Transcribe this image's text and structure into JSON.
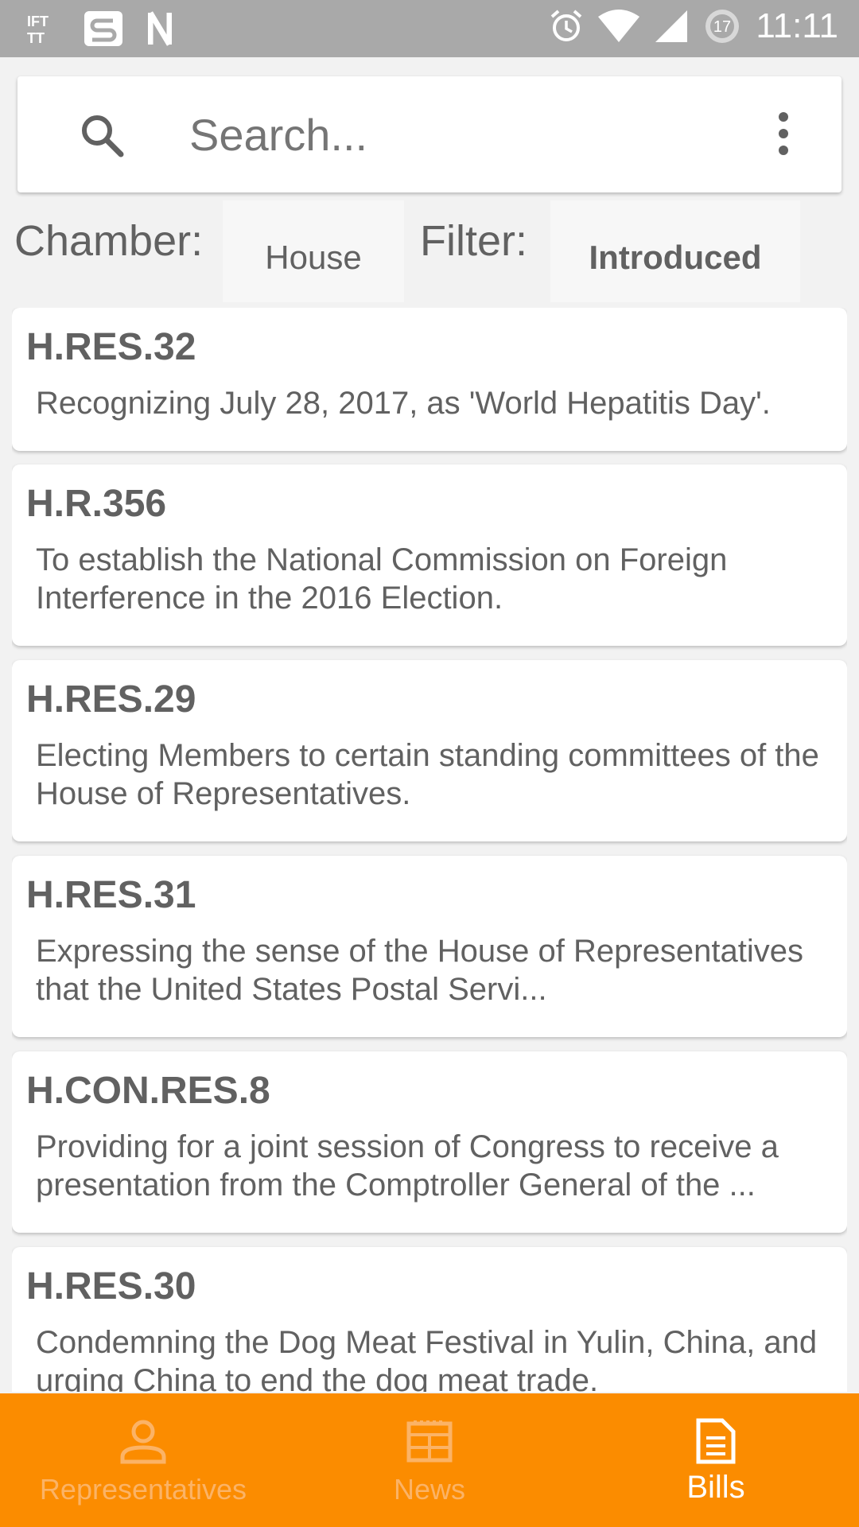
{
  "status_bar": {
    "time": "11:11",
    "badge": "17",
    "left_icons": [
      "ifttt-icon",
      "s-app-icon",
      "n-app-icon"
    ],
    "right_icons": [
      "alarm-icon",
      "wifi-icon",
      "cell-signal-icon",
      "battery-badge-icon"
    ]
  },
  "search": {
    "placeholder": "Search..."
  },
  "filters": {
    "chamber_label": "Chamber:",
    "chamber_value": "House",
    "filter_label": "Filter:",
    "filter_value": "Introduced"
  },
  "bills": [
    {
      "number": "H.RES.32",
      "title": "Recognizing July 28, 2017, as 'World Hepatitis Day'."
    },
    {
      "number": "H.R.356",
      "title": "To establish the National Commission on Foreign Interference in the 2016 Election."
    },
    {
      "number": "H.RES.29",
      "title": "Electing Members to certain standing committees of the House of Representatives."
    },
    {
      "number": "H.RES.31",
      "title": "Expressing the sense of the House of Representatives that the United States Postal Servi..."
    },
    {
      "number": "H.CON.RES.8",
      "title": "Providing for a joint session of Congress to receive a presentation from the Comptroller General of the ..."
    },
    {
      "number": "H.RES.30",
      "title": "Condemning the Dog Meat Festival in Yulin, China, and urging China to end the dog meat trade."
    }
  ],
  "bottom_nav": {
    "items": [
      {
        "label": "Representatives",
        "icon": "person-icon",
        "active": false
      },
      {
        "label": "News",
        "icon": "news-icon",
        "active": false
      },
      {
        "label": "Bills",
        "icon": "document-icon",
        "active": true
      }
    ],
    "background": "#fb8c00"
  }
}
